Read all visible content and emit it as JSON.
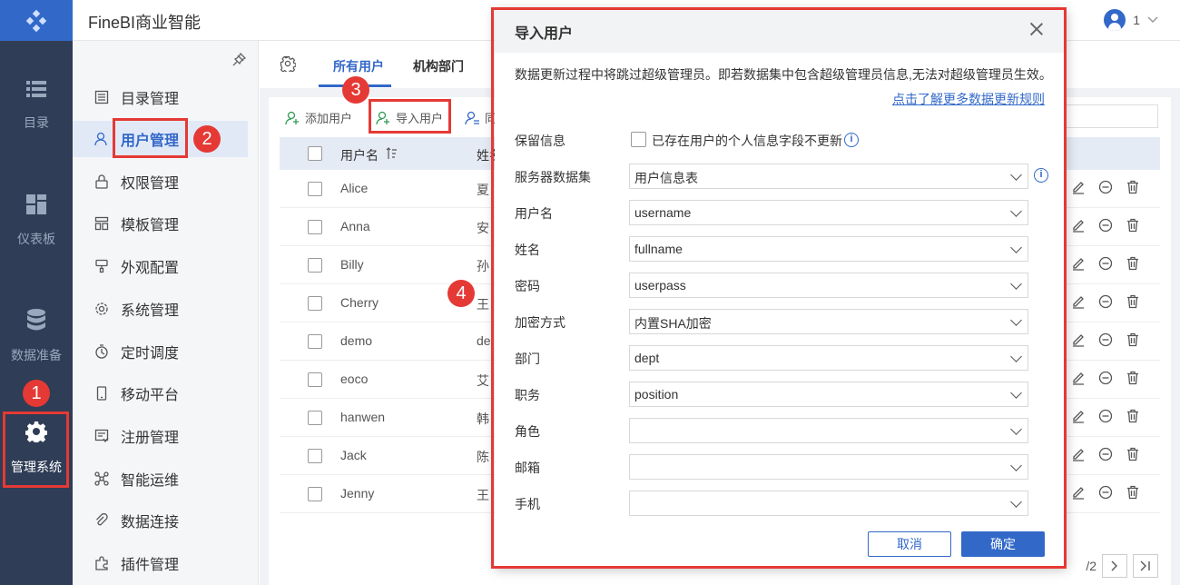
{
  "app": {
    "title": "FineBI商业智能",
    "user_name": "1"
  },
  "rail": {
    "items": [
      {
        "label": "目录",
        "icon": "list-icon"
      },
      {
        "label": "仪表板",
        "icon": "dashboard-icon"
      },
      {
        "label": "数据准备",
        "icon": "database-icon"
      },
      {
        "label": "管理系统",
        "icon": "gear-icon"
      }
    ]
  },
  "menu": {
    "items": [
      {
        "label": "目录管理",
        "icon": "catalog-icon"
      },
      {
        "label": "用户管理",
        "icon": "user-icon"
      },
      {
        "label": "权限管理",
        "icon": "lock-icon"
      },
      {
        "label": "模板管理",
        "icon": "template-icon"
      },
      {
        "label": "外观配置",
        "icon": "brush-icon"
      },
      {
        "label": "系统管理",
        "icon": "settings-icon"
      },
      {
        "label": "定时调度",
        "icon": "timer-icon"
      },
      {
        "label": "移动平台",
        "icon": "mobile-icon"
      },
      {
        "label": "注册管理",
        "icon": "register-icon"
      },
      {
        "label": "智能运维",
        "icon": "ops-icon"
      },
      {
        "label": "数据连接",
        "icon": "link-icon"
      },
      {
        "label": "插件管理",
        "icon": "plugin-icon"
      }
    ]
  },
  "tabs": [
    "所有用户",
    "机构部门"
  ],
  "toolbar": {
    "add_user": "添加用户",
    "import_user": "导入用户",
    "third": "同"
  },
  "table": {
    "headers": [
      "用户名",
      "姓名"
    ],
    "rows": [
      {
        "username": "Alice",
        "name": "夏"
      },
      {
        "username": "Anna",
        "name": "安"
      },
      {
        "username": "Billy",
        "name": "孙"
      },
      {
        "username": "Cherry",
        "name": "王"
      },
      {
        "username": "demo",
        "name": "de"
      },
      {
        "username": "eoco",
        "name": "艾"
      },
      {
        "username": "hanwen",
        "name": "韩"
      },
      {
        "username": "Jack",
        "name": "陈"
      },
      {
        "username": "Jenny",
        "name": "王"
      }
    ]
  },
  "pager": {
    "total": "/2"
  },
  "dialog": {
    "title": "导入用户",
    "notice": "数据更新过程中将跳过超级管理员。即若数据集中包含超级管理员信息,无法对超级管理员生效。",
    "more_link": "点击了解更多数据更新规则",
    "keep_label": "保留信息",
    "keep_checkbox": "已存在用户的个人信息字段不更新",
    "fields": [
      {
        "label": "服务器数据集",
        "value": "用户信息表"
      },
      {
        "label": "用户名",
        "value": "username"
      },
      {
        "label": "姓名",
        "value": "fullname"
      },
      {
        "label": "密码",
        "value": "userpass"
      },
      {
        "label": "加密方式",
        "value": "内置SHA加密"
      },
      {
        "label": "部门",
        "value": "dept"
      },
      {
        "label": "职务",
        "value": "position"
      },
      {
        "label": "角色",
        "value": ""
      },
      {
        "label": "邮箱",
        "value": ""
      },
      {
        "label": "手机",
        "value": ""
      }
    ],
    "cancel": "取消",
    "ok": "确定"
  },
  "steps": [
    "1",
    "2",
    "3",
    "4"
  ],
  "colors": {
    "accent": "#3268c8",
    "rail": "#2f3d56",
    "highlight": "#e53935"
  }
}
